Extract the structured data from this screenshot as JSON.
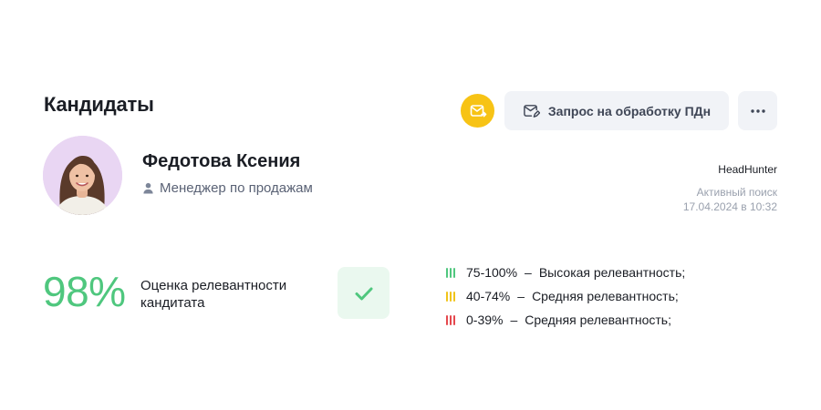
{
  "header": {
    "title": "Кандидаты",
    "mail_button_icon": "mail-forward-icon",
    "pd_request_label": "Запрос на обработку ПДн",
    "pd_request_icon": "mail-edit-icon",
    "more_icon": "more-dots-icon"
  },
  "candidate": {
    "name": "Федотова Ксения",
    "role": "Менеджер по продажам",
    "role_icon": "user-icon",
    "source": "HeadHunter",
    "search_status": "Активный поиск",
    "status_date": "17.04.2024 в 10:32"
  },
  "relevance": {
    "score": "98%",
    "label": "Оценка релевантности кандитата",
    "check_icon": "check-icon",
    "legend": [
      {
        "range": "75-100%",
        "dash": "–",
        "text": "Высокая релевантность;",
        "color": "#4fc77e"
      },
      {
        "range": "40-74%",
        "dash": "–",
        "text": "Средняя релевантность;",
        "color": "#f0c419"
      },
      {
        "range": "0-39%",
        "dash": "–",
        "text": "Средняя релевантность;",
        "color": "#e5484d"
      }
    ]
  },
  "colors": {
    "accent_yellow": "#f7c315",
    "score_green": "#4fc77e",
    "button_bg": "#f1f3f7"
  }
}
